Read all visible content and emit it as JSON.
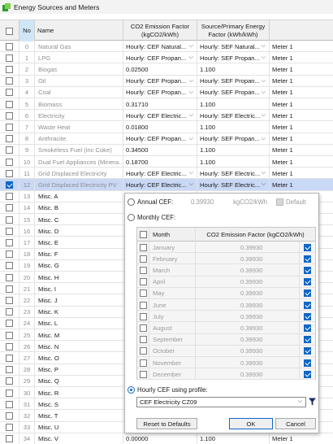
{
  "window": {
    "title": "Energy Sources and Meters"
  },
  "headers": {
    "no": "No",
    "name": "Name",
    "co2": "CO2 Emission Factor (kgCO2/kWh)",
    "source": "Source/Primary Energy Factor (kWh/kWh)"
  },
  "rows": [
    {
      "no": "0",
      "name": "Natural Gas",
      "co2": "Hourly: CEF Natural...",
      "src": "Hourly: SEF Natural...",
      "meter": "Meter 1"
    },
    {
      "no": "1",
      "name": "LPG",
      "co2": "Hourly: CEF Propan...",
      "src": "Hourly: SEF Propan...",
      "meter": "Meter 1"
    },
    {
      "no": "2",
      "name": "Biogas",
      "co2": "0.02500",
      "src": "1.100",
      "meter": "Meter 1"
    },
    {
      "no": "3",
      "name": "Oil",
      "co2": "Hourly: CEF Propan...",
      "src": "Hourly: SEF Propan...",
      "meter": "Meter 1"
    },
    {
      "no": "4",
      "name": "Coal",
      "co2": "Hourly: CEF Propan...",
      "src": "Hourly: SEF Propan...",
      "meter": "Meter 1"
    },
    {
      "no": "5",
      "name": "Biomass",
      "co2": "0.31710",
      "src": "1.100",
      "meter": "Meter 1"
    },
    {
      "no": "6",
      "name": "Electricity",
      "co2": "Hourly: CEF Electric...",
      "src": "Hourly: SEF Electric...",
      "meter": "Meter 1"
    },
    {
      "no": "7",
      "name": "Waste Heat",
      "co2": "0.01800",
      "src": "1.100",
      "meter": "Meter 1"
    },
    {
      "no": "8",
      "name": "Anthracite",
      "co2": "Hourly: CEF Propan...",
      "src": "Hourly: SEF Propan...",
      "meter": "Meter 1"
    },
    {
      "no": "9",
      "name": "Smokeless Fuel (inc Coke)",
      "co2": "0.34500",
      "src": "1.100",
      "meter": "Meter 1"
    },
    {
      "no": "10",
      "name": "Dual Fuel Appliances (Minera...",
      "co2": "0.18700",
      "src": "1.100",
      "meter": "Meter 1"
    },
    {
      "no": "11",
      "name": "Grid Displaced Electricity",
      "co2": "Hourly: CEF Electric...",
      "src": "Hourly: SEF Electric...",
      "meter": "Meter 1"
    },
    {
      "no": "12",
      "name": "Grid Displaced Electricity PV",
      "co2": "Hourly: CEF Electric...",
      "src": "Hourly: SEF Electric...",
      "meter": "Meter 1"
    },
    {
      "no": "13",
      "name": "Misc. A",
      "co2": "",
      "src": "",
      "meter": ""
    },
    {
      "no": "14",
      "name": "Misc. B",
      "co2": "",
      "src": "",
      "meter": ""
    },
    {
      "no": "15",
      "name": "Misc. C",
      "co2": "",
      "src": "",
      "meter": ""
    },
    {
      "no": "16",
      "name": "Misc. D",
      "co2": "",
      "src": "",
      "meter": ""
    },
    {
      "no": "17",
      "name": "Misc. E",
      "co2": "",
      "src": "",
      "meter": ""
    },
    {
      "no": "18",
      "name": "Misc. F",
      "co2": "",
      "src": "",
      "meter": ""
    },
    {
      "no": "19",
      "name": "Misc. G",
      "co2": "",
      "src": "",
      "meter": ""
    },
    {
      "no": "20",
      "name": "Misc. H",
      "co2": "",
      "src": "",
      "meter": ""
    },
    {
      "no": "21",
      "name": "Misc. I",
      "co2": "",
      "src": "",
      "meter": ""
    },
    {
      "no": "22",
      "name": "Misc. J",
      "co2": "",
      "src": "",
      "meter": ""
    },
    {
      "no": "23",
      "name": "Misc. K",
      "co2": "",
      "src": "",
      "meter": ""
    },
    {
      "no": "24",
      "name": "Misc. L",
      "co2": "",
      "src": "",
      "meter": ""
    },
    {
      "no": "25",
      "name": "Misc. M",
      "co2": "",
      "src": "",
      "meter": ""
    },
    {
      "no": "26",
      "name": "Misc. N",
      "co2": "",
      "src": "",
      "meter": ""
    },
    {
      "no": "27",
      "name": "Misc. O",
      "co2": "",
      "src": "",
      "meter": ""
    },
    {
      "no": "28",
      "name": "Misc. P",
      "co2": "",
      "src": "",
      "meter": ""
    },
    {
      "no": "29",
      "name": "Misc. Q",
      "co2": "",
      "src": "",
      "meter": ""
    },
    {
      "no": "30",
      "name": "Misc. R",
      "co2": "",
      "src": "",
      "meter": ""
    },
    {
      "no": "31",
      "name": "Misc. S",
      "co2": "",
      "src": "",
      "meter": ""
    },
    {
      "no": "32",
      "name": "Misc. T",
      "co2": "",
      "src": "",
      "meter": ""
    },
    {
      "no": "33",
      "name": "Misc. U",
      "co2": "",
      "src": "",
      "meter": ""
    },
    {
      "no": "34",
      "name": "Misc. V",
      "co2": "0.00000",
      "src": "1.100",
      "meter": "Meter 1"
    }
  ],
  "popup": {
    "annual_label": "Annual CEF:",
    "annual_value": "0.39930",
    "annual_unit": "kgCO2/kWh",
    "default_label": "Default",
    "monthly_label": "Monthly CEF:",
    "month_header": "Month",
    "cef_header": "CO2 Emission Factor (kgCO2/kWh)",
    "months": [
      {
        "name": "January",
        "value": "0.39930"
      },
      {
        "name": "February",
        "value": "0.39930"
      },
      {
        "name": "March",
        "value": "0.39930"
      },
      {
        "name": "April",
        "value": "0.39930"
      },
      {
        "name": "May",
        "value": "0.39930"
      },
      {
        "name": "June",
        "value": "0.39930"
      },
      {
        "name": "July",
        "value": "0.39930"
      },
      {
        "name": "August",
        "value": "0.39930"
      },
      {
        "name": "September",
        "value": "0.39930"
      },
      {
        "name": "October",
        "value": "0.39930"
      },
      {
        "name": "November",
        "value": "0.39930"
      },
      {
        "name": "December",
        "value": "0.39930"
      }
    ],
    "hourly_label": "Hourly CEF using profile:",
    "profile": "CEF Electricity CZ09",
    "reset_label": "Reset to Defaults",
    "ok_label": "OK",
    "cancel_label": "Cancel"
  },
  "colors": {
    "accent": "#1067c4",
    "selected_row": "#c9d8f5"
  }
}
